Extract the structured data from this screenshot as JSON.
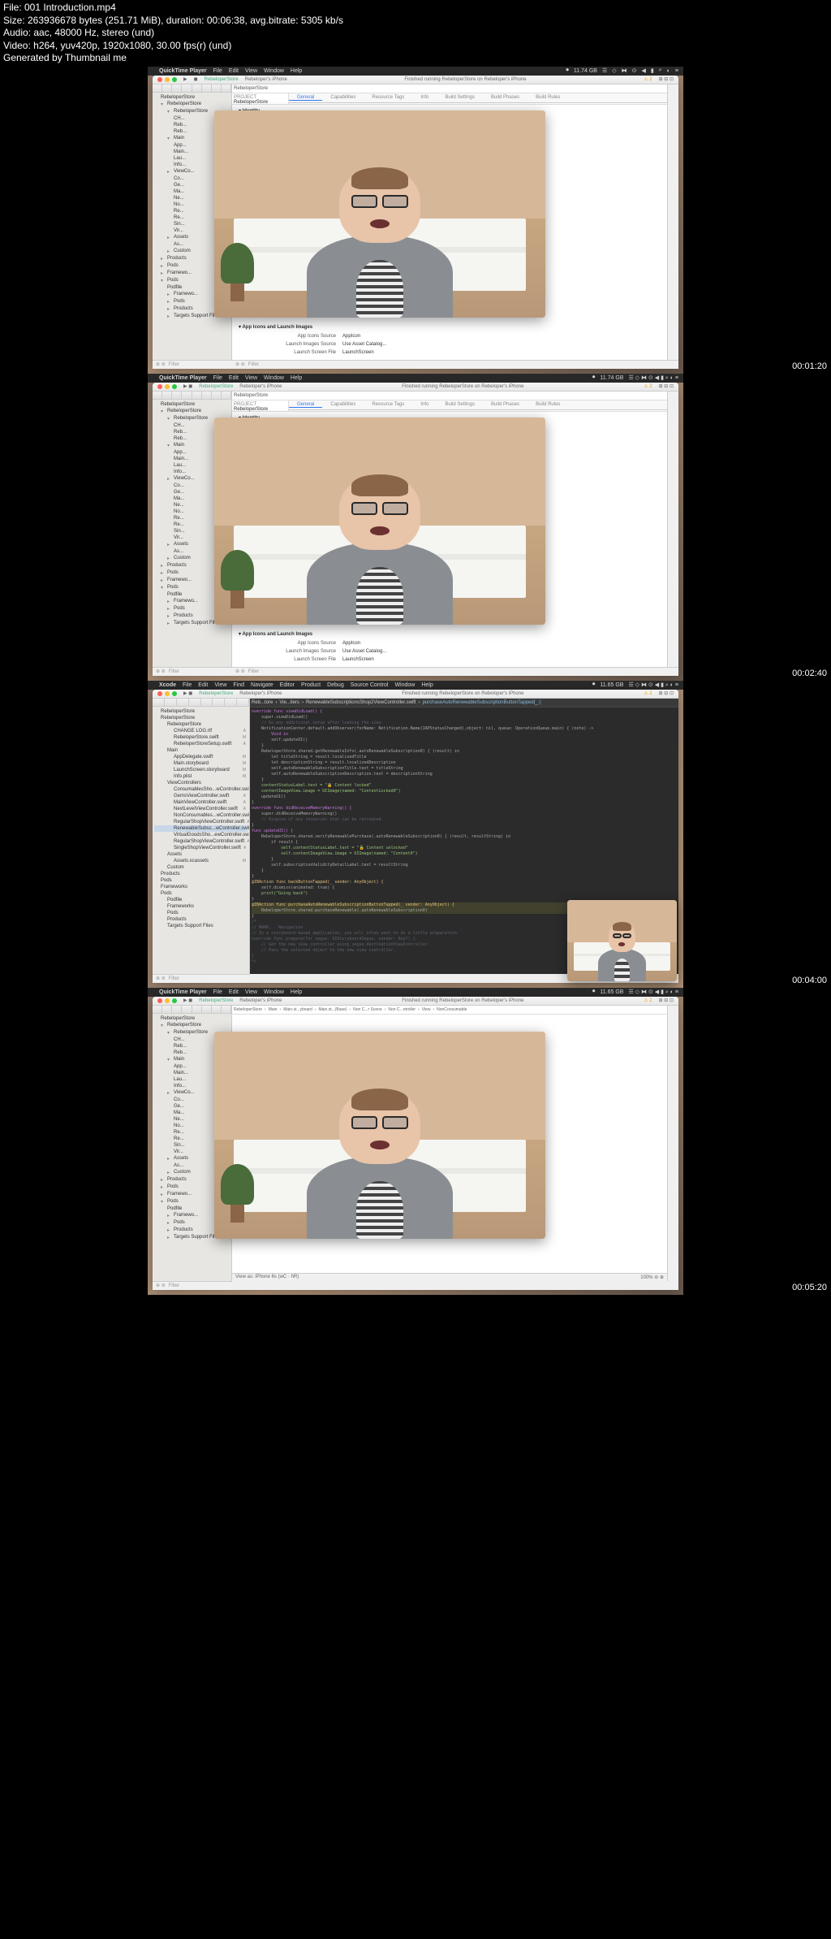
{
  "metadata": {
    "file": "File: 001 Introduction.mp4",
    "size": "Size: 263936678 bytes (251.71 MiB), duration: 00:06:38, avg.bitrate: 5305 kb/s",
    "audio": "Audio: aac, 48000 Hz, stereo (und)",
    "video": "Video: h264, yuv420p, 1920x1080, 30.00 fps(r) (und)",
    "generated": "Generated by Thumbnail me"
  },
  "timestamps": [
    "00:01:20",
    "00:02:40",
    "00:04:00",
    "00:05:20"
  ],
  "menubar_qt": {
    "app": "QuickTime Player",
    "items": [
      "File",
      "Edit",
      "View",
      "Window",
      "Help"
    ],
    "battery": "11.74 GB"
  },
  "menubar_xcode": {
    "app": "Xcode",
    "items": [
      "File",
      "Edit",
      "View",
      "Find",
      "Navigate",
      "Editor",
      "Product",
      "Debug",
      "Source Control",
      "Window",
      "Help"
    ],
    "battery": "11.65 GB"
  },
  "titlebar": {
    "project": "RebeloperStore",
    "target": "Rebeloper's iPhone",
    "status": "Finished running RebeloperStore on Rebeloper's iPhone"
  },
  "tabs": [
    "General",
    "Capabilities",
    "Resource Tags",
    "Info",
    "Build Settings",
    "Build Phases",
    "Build Rules"
  ],
  "project_section": {
    "project_label": "PROJECT",
    "project_name": "RebeloperStore",
    "identity": "▾ Identity"
  },
  "app_icons": {
    "header": "▾ App Icons and Launch Images",
    "rows": [
      {
        "label": "App Icons Source",
        "value": "AppIcon"
      },
      {
        "label": "Launch Images Source",
        "value": "Use Asset Catalog..."
      },
      {
        "label": "Launch Screen File",
        "value": "LaunchScreen"
      }
    ]
  },
  "sidebar_qt": [
    {
      "name": "RebeloperStore",
      "level": 0,
      "icon": "proj"
    },
    {
      "name": "RebeloperStore",
      "level": 1,
      "icon": "folder",
      "open": true
    },
    {
      "name": "RebeloperStore",
      "level": 2,
      "icon": "folder",
      "open": true
    },
    {
      "name": "CH...",
      "level": 3
    },
    {
      "name": "Reb...",
      "level": 3
    },
    {
      "name": "Reb...",
      "level": 3
    },
    {
      "name": "Main",
      "level": 2,
      "icon": "folder",
      "open": true
    },
    {
      "name": "App...",
      "level": 3
    },
    {
      "name": "Main...",
      "level": 3
    },
    {
      "name": "Lau...",
      "level": 3
    },
    {
      "name": "Info...",
      "level": 3
    },
    {
      "name": "ViewCo...",
      "level": 2,
      "icon": "folder"
    },
    {
      "name": "Co...",
      "level": 3
    },
    {
      "name": "Ge...",
      "level": 3
    },
    {
      "name": "Ma...",
      "level": 3
    },
    {
      "name": "Ne...",
      "level": 3
    },
    {
      "name": "No...",
      "level": 3
    },
    {
      "name": "Re...",
      "level": 3
    },
    {
      "name": "Re...",
      "level": 3
    },
    {
      "name": "Sin...",
      "level": 3
    },
    {
      "name": "Vir...",
      "level": 3
    },
    {
      "name": "Assets",
      "level": 2,
      "icon": "folder"
    },
    {
      "name": "As...",
      "level": 3
    },
    {
      "name": "Custom",
      "level": 2,
      "icon": "folder"
    },
    {
      "name": "Products",
      "level": 1,
      "icon": "folder"
    },
    {
      "name": "Pods",
      "level": 1,
      "icon": "folder"
    },
    {
      "name": "Framewo...",
      "level": 1,
      "icon": "folder"
    },
    {
      "name": "Pods",
      "level": 1,
      "icon": "folder",
      "open": true
    },
    {
      "name": "Podfile",
      "level": 2
    },
    {
      "name": "Framewo...",
      "level": 2,
      "icon": "folder"
    },
    {
      "name": "Pods",
      "level": 2,
      "icon": "folder"
    },
    {
      "name": "Products",
      "level": 2,
      "icon": "folder"
    },
    {
      "name": "Targets Support Files",
      "level": 2,
      "icon": "folder"
    }
  ],
  "sidebar_code": {
    "header": "RebeloperStore",
    "items": [
      {
        "name": "RebeloperStore",
        "level": 0
      },
      {
        "name": "RebeloperStore",
        "level": 1
      },
      {
        "name": "RebeloperStore",
        "level": 2
      },
      {
        "name": "CHANGE LOG.rtf",
        "level": 3,
        "status": "A"
      },
      {
        "name": "RebeloperStore.swift",
        "level": 3,
        "status": "M"
      },
      {
        "name": "RebeloperStoreSetup.swift",
        "level": 3,
        "status": "A"
      },
      {
        "name": "Main",
        "level": 2
      },
      {
        "name": "AppDelegate.swift",
        "level": 3,
        "status": "M"
      },
      {
        "name": "Main.storyboard",
        "level": 3,
        "status": "M"
      },
      {
        "name": "LaunchScreen.storyboard",
        "level": 3,
        "status": "M"
      },
      {
        "name": "Info.plist",
        "level": 3,
        "status": "M"
      },
      {
        "name": "ViewControllers",
        "level": 2
      },
      {
        "name": "ConsumablesSho...wController.swift",
        "level": 3,
        "status": "A"
      },
      {
        "name": "GemsViewController.swift",
        "level": 3,
        "status": "A"
      },
      {
        "name": "MainViewController.swift",
        "level": 3,
        "status": "A"
      },
      {
        "name": "NextLevelViewController.swift",
        "level": 3,
        "status": "A"
      },
      {
        "name": "NonConsumables...wController.swift",
        "level": 3,
        "status": "A"
      },
      {
        "name": "RegularShopViewController.swift",
        "level": 3,
        "status": "A"
      },
      {
        "name": "RenewableSubsc...wController.swift",
        "level": 3,
        "status": "A",
        "sel": true
      },
      {
        "name": "VirtualGoodsSho...ewController.swift",
        "level": 3,
        "status": "A"
      },
      {
        "name": "RegularShopViewController.swift",
        "level": 3,
        "status": "A"
      },
      {
        "name": "SingleShopViewController.swift",
        "level": 3,
        "status": "A"
      },
      {
        "name": "Assets",
        "level": 2
      },
      {
        "name": "Assets.xcassets",
        "level": 3,
        "status": "M"
      },
      {
        "name": "Custom",
        "level": 2
      },
      {
        "name": "Products",
        "level": 1
      },
      {
        "name": "Pods",
        "level": 1
      },
      {
        "name": "Frameworks",
        "level": 1
      },
      {
        "name": "Pods",
        "level": 1
      },
      {
        "name": "Podfile",
        "level": 2
      },
      {
        "name": "Frameworks",
        "level": 2
      },
      {
        "name": "Pods",
        "level": 2
      },
      {
        "name": "Products",
        "level": 2
      },
      {
        "name": "Targets Support Files",
        "level": 2
      }
    ]
  },
  "code_crumbs": [
    "Reb...tore",
    "Vie...llers",
    "RenewableSubscriptionsShop2ViewController.swift",
    "purchaseAutoRenewableSubscriptionButtonTapped(_:)"
  ],
  "code_lines": [
    {
      "n": "",
      "t": "override func viewDidLoad() {",
      "cls": "kw"
    },
    {
      "n": "",
      "t": "    super.viewDidLoad()",
      "cls": ""
    },
    {
      "n": "",
      "t": "",
      "cls": ""
    },
    {
      "n": "",
      "t": "    // Do any additional setup after loading the view.",
      "cls": "cm"
    },
    {
      "n": "",
      "t": "",
      "cls": ""
    },
    {
      "n": "",
      "t": "    NotificationCenter.default.addObserver(forName: Notification.Name(IAPStatusChanged),object: nil, queue: OperationQueue.main) { (note) ->",
      "cls": ""
    },
    {
      "n": "",
      "t": "        Void in",
      "cls": "kw"
    },
    {
      "n": "",
      "t": "        self.updateUI()",
      "cls": ""
    },
    {
      "n": "",
      "t": "    }",
      "cls": ""
    },
    {
      "n": "",
      "t": "",
      "cls": ""
    },
    {
      "n": "",
      "t": "    RebeloperStore.shared.getRenewableInfo(.autoRenewableSubscription0) { (result) in",
      "cls": ""
    },
    {
      "n": "",
      "t": "        let titleString = result.localizedTitle",
      "cls": ""
    },
    {
      "n": "",
      "t": "        let descriptionString = result.localizedDescription",
      "cls": ""
    },
    {
      "n": "",
      "t": "",
      "cls": ""
    },
    {
      "n": "",
      "t": "        self.autoRenewableSubscriptionTitle.text = titleString",
      "cls": ""
    },
    {
      "n": "",
      "t": "        self.autoRenewableSubscriptionDescription.text = descriptionString",
      "cls": ""
    },
    {
      "n": "",
      "t": "    }",
      "cls": ""
    },
    {
      "n": "",
      "t": "",
      "cls": ""
    },
    {
      "n": "",
      "t": "    contentStatusLabel.text = \"🔒 Content locked\"",
      "cls": "str"
    },
    {
      "n": "",
      "t": "    contentImageView.image = UIImage(named: \"ContentLocked0\")",
      "cls": "str"
    },
    {
      "n": "",
      "t": "    updateUI()",
      "cls": ""
    },
    {
      "n": "",
      "t": "}",
      "cls": ""
    },
    {
      "n": "",
      "t": "",
      "cls": ""
    },
    {
      "n": "",
      "t": "override func didReceiveMemoryWarning() {",
      "cls": "kw"
    },
    {
      "n": "",
      "t": "    super.didReceiveMemoryWarning()",
      "cls": ""
    },
    {
      "n": "",
      "t": "    // Dispose of any resources that can be recreated.",
      "cls": "cm"
    },
    {
      "n": "",
      "t": "}",
      "cls": ""
    },
    {
      "n": "",
      "t": "",
      "cls": ""
    },
    {
      "n": "",
      "t": "func updateUI() {",
      "cls": "kw"
    },
    {
      "n": "",
      "t": "    RebeloperStore.shared.verifyRenewablePurchase(.autoRenewableSubscription0) { (result, resultString) in",
      "cls": ""
    },
    {
      "n": "",
      "t": "        if result {",
      "cls": ""
    },
    {
      "n": "",
      "t": "            self.contentStatusLabel.text = \"🔓 Content unlocked\"",
      "cls": "str"
    },
    {
      "n": "",
      "t": "            self.contentImageView.image = UIImage(named: \"Content0\")",
      "cls": "str"
    },
    {
      "n": "",
      "t": "        }",
      "cls": ""
    },
    {
      "n": "",
      "t": "        self.subscriptionValidityDetailLabel.text = resultString",
      "cls": ""
    },
    {
      "n": "",
      "t": "    }",
      "cls": ""
    },
    {
      "n": "",
      "t": "}",
      "cls": ""
    },
    {
      "n": "",
      "t": "",
      "cls": ""
    },
    {
      "n": "",
      "t": "@IBAction func backButtonTapped(_ sender: AnyObject) {",
      "cls": "fn"
    },
    {
      "n": "",
      "t": "    self.dismiss(animated: true) {",
      "cls": ""
    },
    {
      "n": "",
      "t": "    print(\"Going back\")",
      "cls": "str"
    },
    {
      "n": "",
      "t": "}",
      "cls": ""
    },
    {
      "n": "",
      "t": "",
      "cls": ""
    },
    {
      "n": "",
      "t": "@IBAction func purchaseAutoRenewableSubscriptionButtonTapped(_ sender: AnyObject) {",
      "cls": "fn hl"
    },
    {
      "n": "",
      "t": "    RebeloperStore.shared.purchaseRenewable(.autoRenewableSubscription0)",
      "cls": "hl"
    },
    {
      "n": "",
      "t": "}",
      "cls": ""
    },
    {
      "n": "",
      "t": "",
      "cls": ""
    },
    {
      "n": "",
      "t": "/*",
      "cls": "cm"
    },
    {
      "n": "",
      "t": "// MARK: - Navigation",
      "cls": "cm"
    },
    {
      "n": "",
      "t": "",
      "cls": ""
    },
    {
      "n": "",
      "t": "// In a storyboard-based application, you will often want to do a little preparation",
      "cls": "cm"
    },
    {
      "n": "",
      "t": "override func prepare(for segue: UIStoryboardSegue, sender: Any?) {",
      "cls": "cm"
    },
    {
      "n": "",
      "t": "    // Get the new view controller using segue.destinationViewController.",
      "cls": "cm"
    },
    {
      "n": "",
      "t": "    // Pass the selected object to the new view controller.",
      "cls": "cm"
    },
    {
      "n": "",
      "t": "}",
      "cls": "cm"
    },
    {
      "n": "",
      "t": "*/",
      "cls": "cm"
    }
  ],
  "storyboard_crumbs": [
    "RebeloperStore",
    "Main",
    "Main.st...yboard",
    "Main.st...(Base)",
    "Non C...r Scene",
    "Non C...ntroller",
    "View",
    "NonConsumable"
  ],
  "filter_text": "Filter",
  "view_as": "View as: iPhone 6s (wC · hR)"
}
